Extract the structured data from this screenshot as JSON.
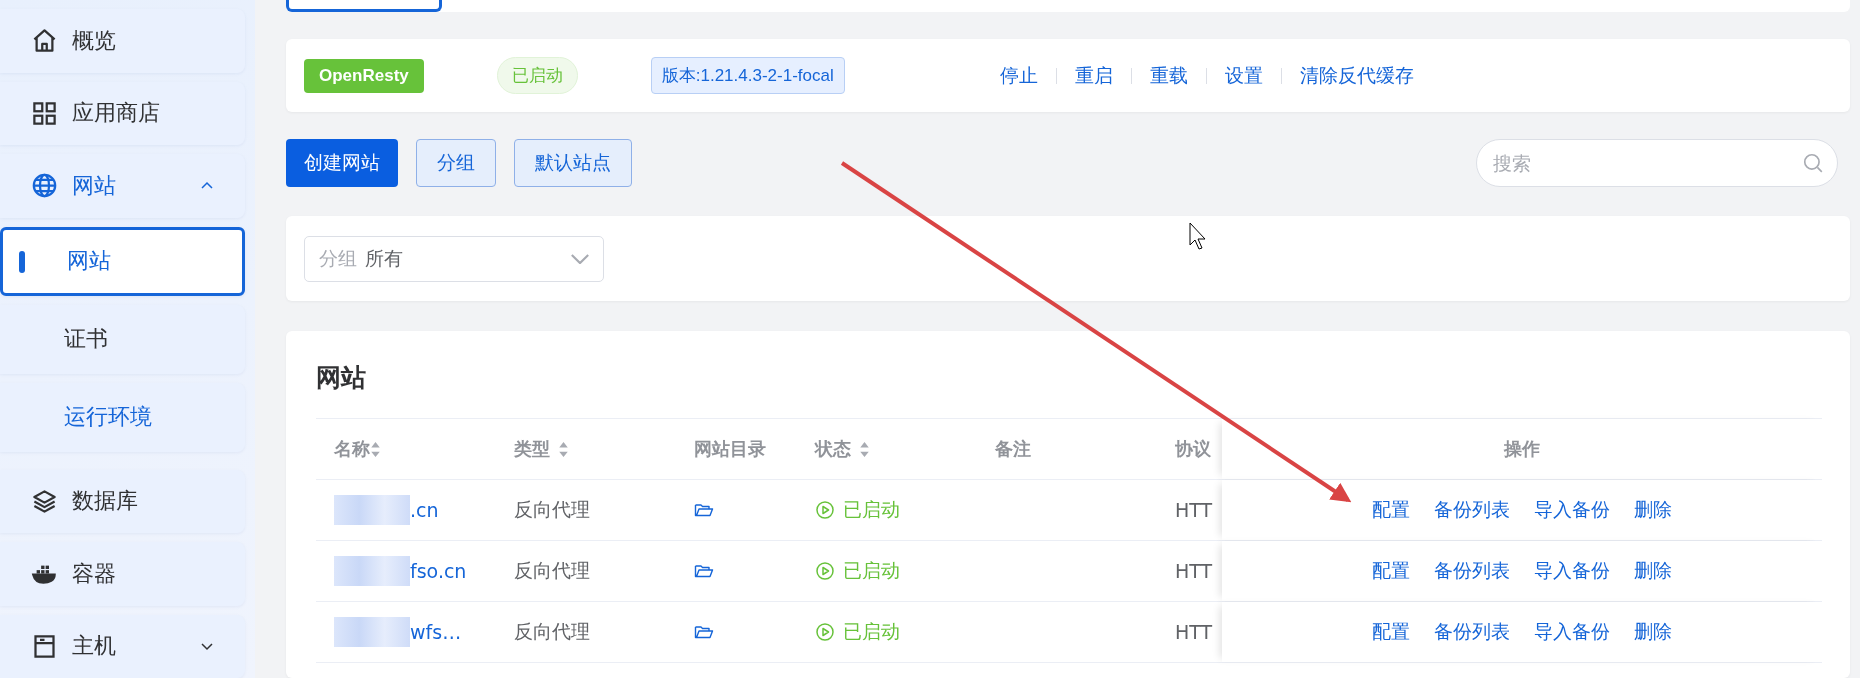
{
  "sidebar": {
    "items": [
      {
        "label": "概览",
        "selected": false
      },
      {
        "label": "应用商店",
        "selected": false
      },
      {
        "label": "网站",
        "selected": false,
        "expanded": true,
        "children": [
          {
            "label": "网站",
            "selected": true
          },
          {
            "label": "证书",
            "selected": false
          },
          {
            "label": "运行环境",
            "selected": false
          }
        ]
      },
      {
        "label": "数据库",
        "selected": false
      },
      {
        "label": "容器",
        "selected": false
      },
      {
        "label": "主机",
        "selected": false,
        "expanded": false
      }
    ]
  },
  "server": {
    "name": "OpenResty",
    "status": "已启动",
    "version": "版本:1.21.4.3-2-1-focal",
    "actions": [
      "停止",
      "重启",
      "重载",
      "设置",
      "清除反代缓存"
    ]
  },
  "toolbar": {
    "buttons": [
      {
        "label": "创建网站",
        "kind": "primary"
      },
      {
        "label": "分组",
        "kind": "plain"
      },
      {
        "label": "默认站点",
        "kind": "plain"
      }
    ],
    "search": {
      "placeholder": "搜索"
    }
  },
  "filter": {
    "label": "分组",
    "value": "所有"
  },
  "table": {
    "title": "网站",
    "columns": [
      {
        "label": "名称",
        "sortable": true
      },
      {
        "label": "类型",
        "sortable": true
      },
      {
        "label": "网站目录",
        "sortable": false
      },
      {
        "label": "状态",
        "sortable": true
      },
      {
        "label": "备注",
        "sortable": false
      },
      {
        "label": "协议",
        "sortable": false
      },
      {
        "label": "操作",
        "sortable": false
      }
    ],
    "rows": [
      {
        "name": ".cn",
        "type": "反向代理",
        "status": "已启动",
        "protocol": "HTT",
        "actions": [
          "配置",
          "备份列表",
          "导入备份",
          "删除"
        ]
      },
      {
        "name": "fso.cn",
        "type": "反向代理",
        "status": "已启动",
        "protocol": "HTT",
        "actions": [
          "配置",
          "备份列表",
          "导入备份",
          "删除"
        ]
      },
      {
        "name": "wfs…",
        "type": "反向代理",
        "status": "已启动",
        "protocol": "HTT",
        "actions": [
          "配置",
          "备份列表",
          "导入备份",
          "删除"
        ]
      }
    ]
  }
}
